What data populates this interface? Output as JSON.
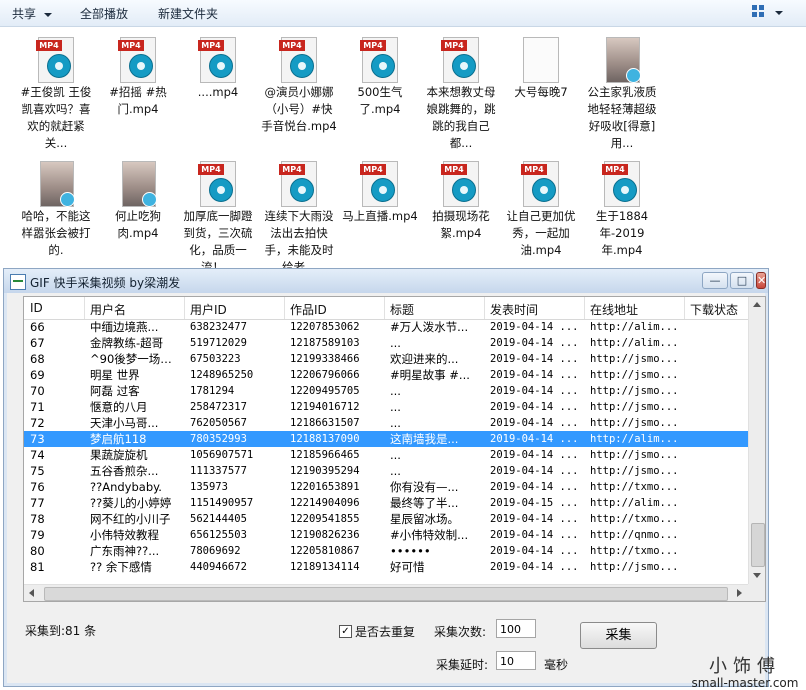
{
  "toolbar": {
    "share": "共享",
    "play_all": "全部播放",
    "new_folder": "新建文件夹"
  },
  "files": [
    {
      "name": "#王俊凯 王俊凯喜欢吗？喜欢的就赶紧关...",
      "kind": "mp4"
    },
    {
      "name": "#招摇 #热门.mp4",
      "kind": "mp4"
    },
    {
      "name": "....mp4",
      "kind": "mp4"
    },
    {
      "name": "@演员小娜娜（小号）#快手音悦台.mp4",
      "kind": "mp4"
    },
    {
      "name": "500生气了.mp4",
      "kind": "mp4"
    },
    {
      "name": "本来想教丈母娘跳舞的，跳跳的我自己都...",
      "kind": "mp4"
    },
    {
      "name": "大号每晚7",
      "kind": "blank"
    },
    {
      "name": "公主家乳液质地轻轻薄超级好吸收[得意]用...",
      "kind": "thumb"
    },
    {
      "name": "哈哈，不能这样嚣张会被打的.",
      "kind": "thumb"
    },
    {
      "name": "何止吃狗肉.mp4",
      "kind": "thumb"
    },
    {
      "name": "加厚底一脚蹬到货，三次硫化，品质一流！...",
      "kind": "mp4"
    },
    {
      "name": "连续下大雨没法出去拍快手，未能及时给老...",
      "kind": "mp4"
    },
    {
      "name": "马上直播.mp4",
      "kind": "mp4"
    },
    {
      "name": "拍摄现场花絮.mp4",
      "kind": "mp4"
    },
    {
      "name": "让自己更加优秀，一起加油.mp4",
      "kind": "mp4"
    },
    {
      "name": "生于1884年-2019年.mp4",
      "kind": "mp4"
    }
  ],
  "mp4_badge": "MP4",
  "window": {
    "title": "GIF 快手采集视频 by梁潮发",
    "min": "—",
    "max": "□",
    "close": "✕"
  },
  "table": {
    "headers": [
      "ID",
      "用户名",
      "用户ID",
      "作品ID",
      "标题",
      "发表时间",
      "在线地址",
      "下载状态"
    ],
    "rows": [
      [
        "66",
        "中缅边境燕...",
        "638232477",
        "12207853062",
        "#万人泼水节...",
        "2019-04-14 ...",
        "http://alim...",
        ""
      ],
      [
        "67",
        "金牌教练-超哥",
        "519712029",
        "12187589103",
        "...",
        "2019-04-14 ...",
        "http://alim...",
        ""
      ],
      [
        "68",
        "^90後梦一场…",
        "67503223",
        "12199338466",
        "欢迎进来的...",
        "2019-04-14 ...",
        "http://jsmo...",
        ""
      ],
      [
        "69",
        "明星 世界",
        "1248965250",
        "12206796066",
        "#明星故事 #...",
        "2019-04-14 ...",
        "http://jsmo...",
        ""
      ],
      [
        "70",
        "阿磊 过客",
        "1781294",
        "12209495705",
        "...",
        "2019-04-14 ...",
        "http://jsmo...",
        ""
      ],
      [
        "71",
        "惬意的八月",
        "258472317",
        "12194016712",
        "...",
        "2019-04-14 ...",
        "http://jsmo...",
        ""
      ],
      [
        "72",
        "天津小马哥...",
        "762050567",
        "12186631507",
        "...",
        "2019-04-14 ...",
        "http://jsmo...",
        ""
      ],
      [
        "73",
        "梦启航118",
        "780352993",
        "12188137090",
        "这南墙我是...",
        "2019-04-14 ...",
        "http://alim...",
        ""
      ],
      [
        "74",
        "果蔬旋旋机",
        "1056907571",
        "12185966465",
        "...",
        "2019-04-14 ...",
        "http://jsmo...",
        ""
      ],
      [
        "75",
        "五谷香煎杂...",
        "111337577",
        "12190395294",
        "...",
        "2019-04-14 ...",
        "http://jsmo...",
        ""
      ],
      [
        "76",
        "??Andybaby.",
        "135973",
        "12201653891",
        "你有没有—...",
        "2019-04-14 ...",
        "http://txmo...",
        ""
      ],
      [
        "77",
        "??葵儿的小婷婷",
        "1151490957",
        "12214904096",
        "最终等了半...",
        "2019-04-15 ...",
        "http://alim...",
        ""
      ],
      [
        "78",
        "网不红的小川子",
        "562144405",
        "12209541855",
        "星辰留冰场。",
        "2019-04-14 ...",
        "http://txmo...",
        ""
      ],
      [
        "79",
        "小伟特效教程",
        "656125503",
        "12190826236",
        "#小伟特效制...",
        "2019-04-14 ...",
        "http://qnmo...",
        ""
      ],
      [
        "80",
        "广东雨神??...",
        "78069692",
        "12205810867",
        "••••••",
        "2019-04-14 ...",
        "http://txmo...",
        ""
      ],
      [
        "81",
        "??  余下感情",
        "440946672",
        "12189134114",
        "好可惜",
        "2019-04-14 ...",
        "http://jsmo...",
        ""
      ]
    ],
    "selected_id": "73"
  },
  "status": {
    "collected_label": "采集到:81 条"
  },
  "controls": {
    "dedupe_label": "是否去重复",
    "dedupe_checked": "✓",
    "count_label": "采集次数:",
    "count_value": "100",
    "delay_label": "采集延时:",
    "delay_value": "10",
    "delay_unit": "毫秒",
    "collect_button": "采集"
  },
  "watermark": {
    "line1": "小饰傅",
    "line2": "small-master.com"
  }
}
